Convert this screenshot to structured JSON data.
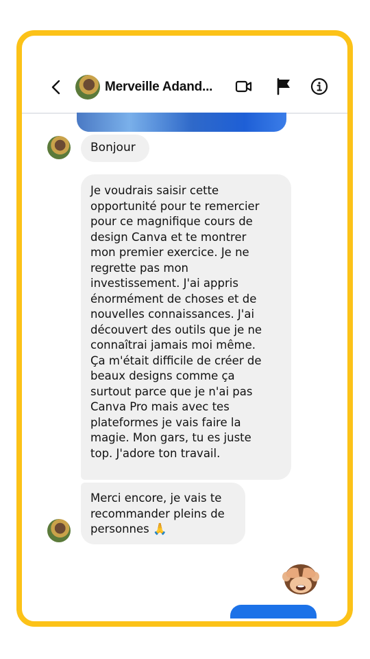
{
  "contact": {
    "name": "Merveille Adand..."
  },
  "messages": [
    {
      "text": "Bonjour"
    },
    {
      "text": "Je voudrais saisir cette\nopportunité pour te remercier\npour ce magnifique cours de\ndesign Canva et te montrer\nmon premier exercice. Je ne\nregrette pas mon\ninvestissement. J'ai appris\nénormément de choses et de\nnouvelles connaissances. J'ai\ndécouvert des outils que je ne\nconnaîtrai jamais moi même.\nÇa m'était difficile de créer de\nbeaux designs comme ça\nsurtout parce que je n'ai pas\nCanva Pro mais avec tes\nplateformes je vais faire la\nmagie. Mon gars, tu es juste\ntop. J'adore ton travail."
    },
    {
      "text": "Merci encore, je vais te\nrecommander pleins de\npersonnes 🙏"
    }
  ],
  "colors": {
    "frame_border": "#fcc218",
    "bubble_bg": "#f0f0f0",
    "sent_bubble": "#1c72e8"
  },
  "icons": [
    "chevron-left-icon",
    "video-camera-icon",
    "flag-icon",
    "info-icon",
    "see-no-evil-monkey-emoji",
    "folded-hands-emoji"
  ]
}
